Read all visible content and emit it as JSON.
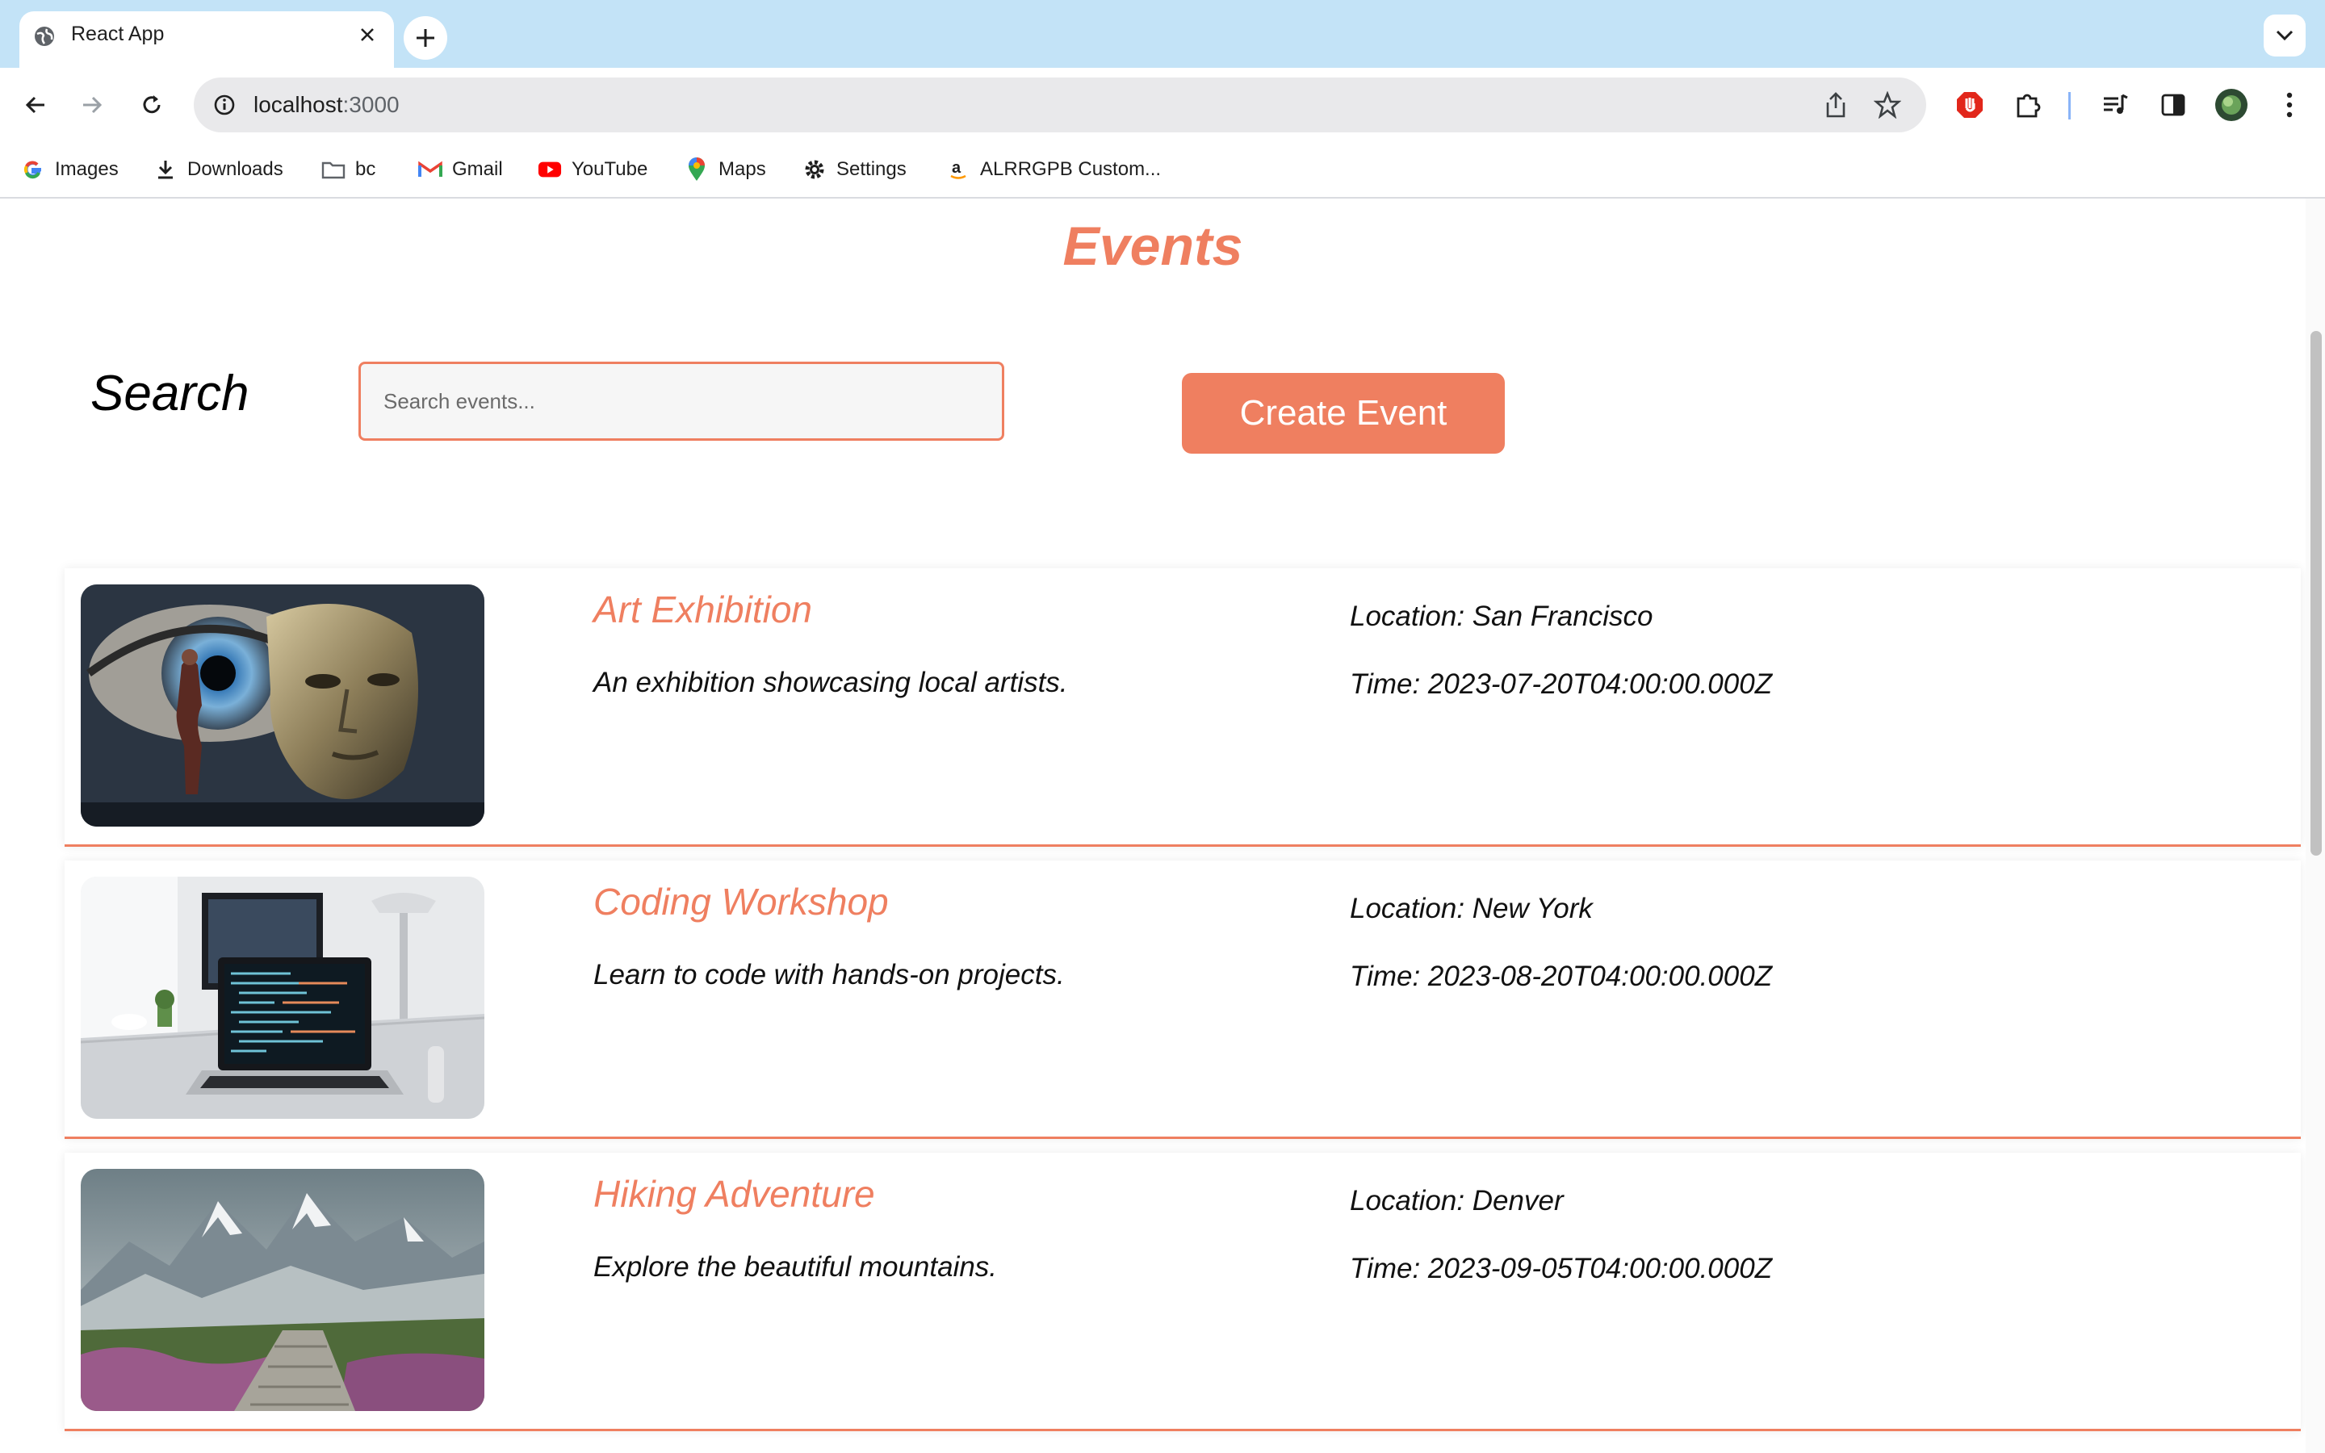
{
  "browser": {
    "tab_title": "React App",
    "url_host": "localhost",
    "url_port": ":3000",
    "bookmarks": [
      {
        "label": "Images",
        "icon": "google-icon"
      },
      {
        "label": "Downloads",
        "icon": "download-icon"
      },
      {
        "label": "bc",
        "icon": "folder-icon"
      },
      {
        "label": "Gmail",
        "icon": "gmail-icon"
      },
      {
        "label": "YouTube",
        "icon": "youtube-icon"
      },
      {
        "label": "Maps",
        "icon": "maps-pin-icon"
      },
      {
        "label": "Settings",
        "icon": "gear-icon"
      },
      {
        "label": "ALRRGPB Custom...",
        "icon": "amazon-icon"
      }
    ]
  },
  "page": {
    "title": "Events",
    "search_label": "Search",
    "search_placeholder": "Search events...",
    "search_value": "",
    "create_button_label": "Create Event"
  },
  "events": [
    {
      "name": "Art Exhibition",
      "description": "An exhibition showcasing local artists.",
      "location": "Location: San Francisco",
      "time": "Time: 2023-07-20T04:00:00.000Z",
      "image": "mask-art-image"
    },
    {
      "name": "Coding Workshop",
      "description": "Learn to code with hands-on projects.",
      "location": "Location: New York",
      "time": "Time: 2023-08-20T04:00:00.000Z",
      "image": "laptop-desk-image"
    },
    {
      "name": "Hiking Adventure",
      "description": "Explore the beautiful mountains.",
      "location": "Location: Denver",
      "time": "Time: 2023-09-05T04:00:00.000Z",
      "image": "mountain-trail-image"
    }
  ],
  "colors": {
    "accent": "#ef7f60",
    "tabstrip": "#c3e3f7"
  }
}
